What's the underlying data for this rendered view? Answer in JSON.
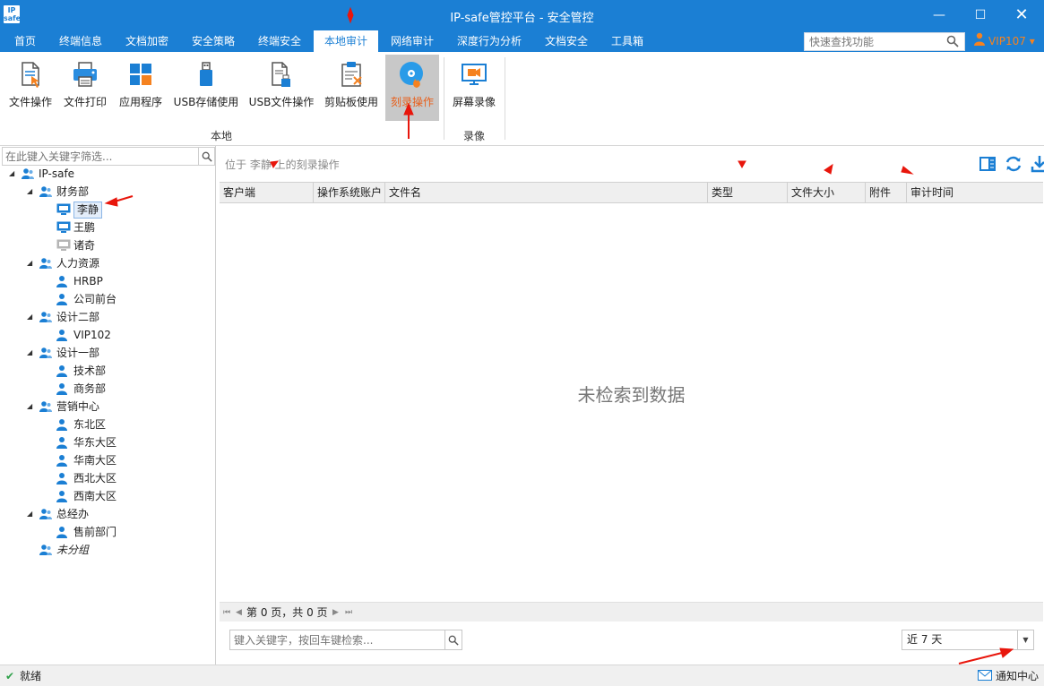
{
  "window": {
    "logo_text": "IP safe",
    "title": "IP-safe管控平台 - 安全管控",
    "min_glyph": "—",
    "max_glyph": "☐",
    "close_glyph": "✕"
  },
  "menu": {
    "items": [
      "首页",
      "终端信息",
      "文档加密",
      "安全策略",
      "终端安全",
      "本地审计",
      "网络审计",
      "深度行为分析",
      "文档安全",
      "工具箱"
    ],
    "active": "本地审计",
    "quick_search_placeholder": "快速查找功能",
    "user": "VIP107",
    "user_caret": "▾"
  },
  "ribbon": {
    "buttons": [
      {
        "label": "文件操作",
        "icon": "file-operation-icon"
      },
      {
        "label": "文件打印",
        "icon": "printer-icon"
      },
      {
        "label": "应用程序",
        "icon": "app-grid-icon"
      },
      {
        "label": "USB存储使用",
        "icon": "usb-drive-icon"
      },
      {
        "label": "USB文件操作",
        "icon": "usb-file-icon"
      },
      {
        "label": "剪贴板使用",
        "icon": "clipboard-icon"
      },
      {
        "label": "刻录操作",
        "icon": "disc-burn-icon",
        "active": true
      },
      {
        "label": "屏幕录像",
        "icon": "screen-record-icon"
      }
    ],
    "groups": [
      "本地",
      "录像"
    ]
  },
  "tree": {
    "filter_placeholder": "在此键入关键字筛选...",
    "root": "IP-safe",
    "depts": [
      {
        "name": "财务部",
        "members": [
          {
            "name": "李静",
            "type": "pc",
            "selected": true
          },
          {
            "name": "王鹏",
            "type": "pc"
          },
          {
            "name": "诸奇",
            "type": "pc-offline"
          }
        ]
      },
      {
        "name": "人力资源",
        "members": [
          {
            "name": "HRBP"
          },
          {
            "name": "公司前台"
          }
        ]
      },
      {
        "name": "设计二部",
        "members": [
          {
            "name": "VIP102"
          }
        ]
      },
      {
        "name": "设计一部",
        "members": [
          {
            "name": "技术部"
          },
          {
            "name": "商务部"
          }
        ]
      },
      {
        "name": "营销中心",
        "members": [
          {
            "name": "东北区"
          },
          {
            "name": "华东大区"
          },
          {
            "name": "华南大区"
          },
          {
            "name": "西北大区"
          },
          {
            "name": "西南大区"
          }
        ]
      },
      {
        "name": "总经办",
        "members": [
          {
            "name": "售前部门"
          }
        ]
      }
    ],
    "ungrouped": "未分组"
  },
  "content": {
    "location": "位于 李静 上的刻录操作",
    "columns": [
      "客户端",
      "操作系统账户",
      "文件名",
      "类型",
      "文件大小",
      "附件",
      "审计时间"
    ],
    "empty_message": "未检索到数据",
    "pager_text": "第 0 页，共 0 页",
    "search_placeholder": "键入关键字，按回车键检索...",
    "range_value": "近 7 天"
  },
  "status": {
    "left": "就绪",
    "right": "通知中心"
  },
  "colors": {
    "brand_blue": "#1b7fd4",
    "accent_orange": "#f58220",
    "annotation_red": "#e8160c"
  }
}
